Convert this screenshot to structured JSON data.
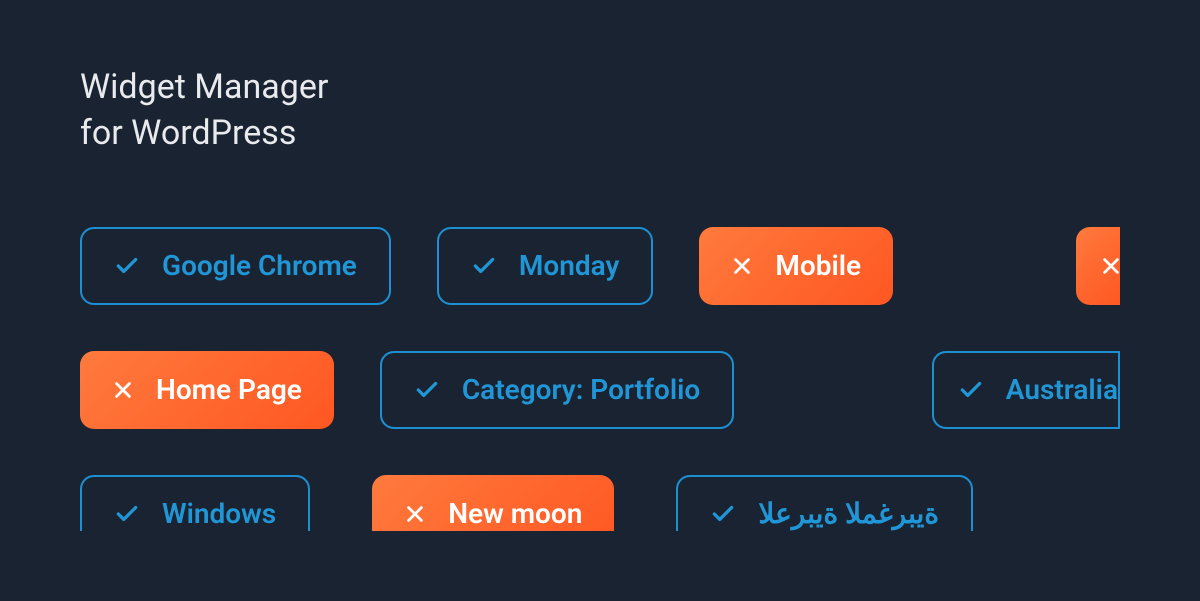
{
  "title_line1": "Widget Manager",
  "title_line2": "for WordPress",
  "rows": [
    [
      {
        "label": "Google Chrome",
        "kind": "outline",
        "icon": "check"
      },
      {
        "label": "Monday",
        "kind": "outline",
        "icon": "check"
      },
      {
        "label": "Mobile",
        "kind": "filled",
        "icon": "cross"
      },
      {
        "label": "",
        "kind": "filled",
        "icon": "cross"
      }
    ],
    [
      {
        "label": "Home Page",
        "kind": "filled",
        "icon": "cross"
      },
      {
        "label": "Category: Portfolio",
        "kind": "outline",
        "icon": "check"
      },
      {
        "label": "Australia",
        "kind": "outline",
        "icon": "check"
      }
    ],
    [
      {
        "label": "Windows",
        "kind": "outline",
        "icon": "check"
      },
      {
        "label": "New moon",
        "kind": "filled",
        "icon": "cross"
      },
      {
        "label": "ةيبرغملا ةيبرعلا",
        "kind": "outline",
        "icon": "check"
      }
    ]
  ]
}
